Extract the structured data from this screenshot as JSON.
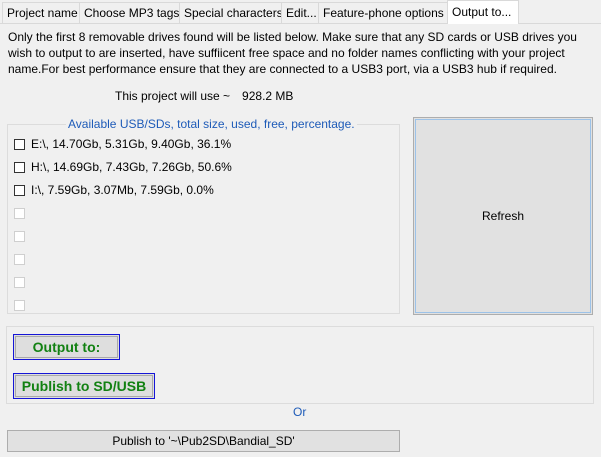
{
  "tabs": [
    {
      "label": "Project name"
    },
    {
      "label": "Choose MP3 tags"
    },
    {
      "label": "Special characters"
    },
    {
      "label": "Edit..."
    },
    {
      "label": "Feature-phone options"
    },
    {
      "label": "Output to..."
    }
  ],
  "intro_text": "Only the first 8 removable drives found will be listed below. Make sure that any SD cards or USB drives you wish to output to are inserted, have suffiicent free space and no folder names conflicting with your project name.For best performance ensure that they are connected to a USB3 port, via a USB3 hub if required.",
  "usage": {
    "label": "This project will use ~",
    "value": "928.2 MB"
  },
  "drives_group": {
    "title": "Available USB/SDs, total size, used, free, percentage.",
    "drives": [
      {
        "label": "E:\\, 14.70Gb, 5.31Gb, 9.40Gb, 36.1%",
        "checked": false
      },
      {
        "label": "H:\\, 14.69Gb, 7.43Gb, 7.26Gb, 50.6%",
        "checked": false
      },
      {
        "label": "I:\\, 7.59Gb, 3.07Mb, 7.59Gb, 0.0%",
        "checked": false
      }
    ],
    "empty_slots": 5
  },
  "refresh_label": "Refresh",
  "output_to_label": "Output to:",
  "publish_label": "Publish to SD/USB",
  "or_label": "Or",
  "publish_path_label": "Publish to '~\\Pub2SD\\Bandial_SD'",
  "colors": {
    "green_text": "#128112",
    "blue_border": "#1515d6",
    "blue_text": "#1e5bb8"
  }
}
